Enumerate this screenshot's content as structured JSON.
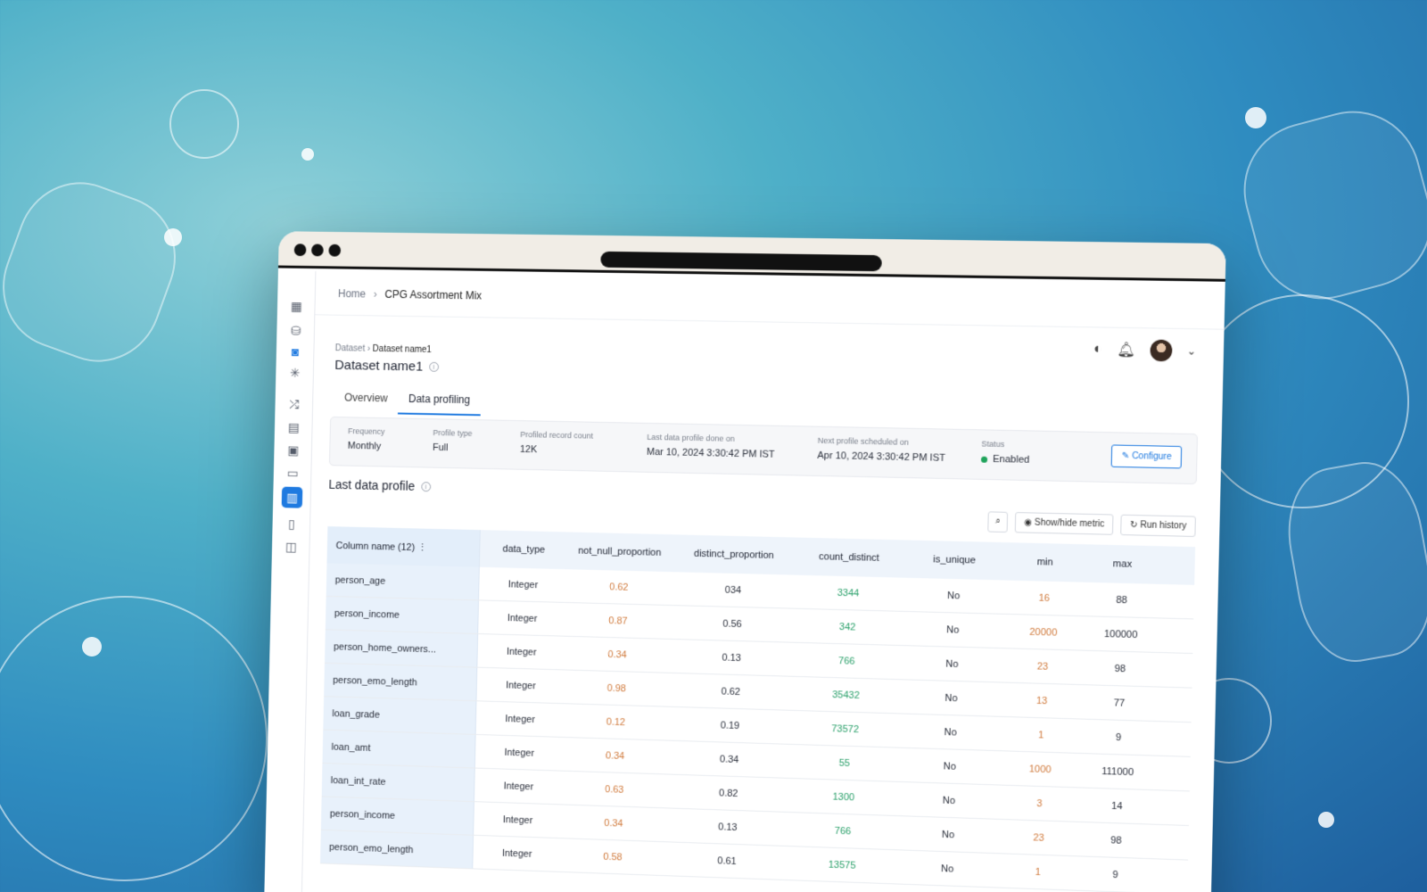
{
  "window": {
    "breadcrumb": {
      "home": "Home",
      "current": "CPG Assortment Mix"
    }
  },
  "header_icons": [
    "theme-toggle-icon",
    "bell-icon",
    "avatar",
    "chevron-down-icon"
  ],
  "dataset": {
    "crumb_parent": "Dataset",
    "crumb_current": "Dataset name1",
    "title": "Dataset name1"
  },
  "tabs": [
    {
      "label": "Overview",
      "active": false
    },
    {
      "label": "Data profiling",
      "active": true
    }
  ],
  "meta": {
    "frequency": {
      "label": "Frequency",
      "value": "Monthly"
    },
    "profile_type": {
      "label": "Profile type",
      "value": "Full"
    },
    "record_count": {
      "label": "Profiled record count",
      "value": "12K"
    },
    "last_profile": {
      "label": "Last data profile done on",
      "value": "Mar 10, 2024 3:30:42 PM IST"
    },
    "next_profile": {
      "label": "Next profile scheduled on",
      "value": "Apr 10, 2024 3:30:42 PM IST"
    },
    "status": {
      "label": "Status",
      "value": "Enabled",
      "color": "#1fa35b"
    },
    "configure_label": "Configure"
  },
  "profile": {
    "section_title": "Last data profile",
    "show_hide_label": "Show/hide metric",
    "run_history_label": "Run history",
    "columns": [
      "Column name (12) ⋮",
      "data_type",
      "not_null_proportion",
      "distinct_proportion",
      "count_distinct",
      "is_unique",
      "min",
      "max"
    ],
    "rows": [
      [
        "person_age",
        "Integer",
        "0.62",
        "034",
        "3344",
        "No",
        "16",
        "88"
      ],
      [
        "person_income",
        "Integer",
        "0.87",
        "0.56",
        "342",
        "No",
        "20000",
        "100000"
      ],
      [
        "person_home_owners...",
        "Integer",
        "0.34",
        "0.13",
        "766",
        "No",
        "23",
        "98"
      ],
      [
        "person_emo_length",
        "Integer",
        "0.98",
        "0.62",
        "35432",
        "No",
        "13",
        "77"
      ],
      [
        "loan_grade",
        "Integer",
        "0.12",
        "0.19",
        "73572",
        "No",
        "1",
        "9"
      ],
      [
        "loan_amt",
        "Integer",
        "0.34",
        "0.34",
        "55",
        "No",
        "1000",
        "111000"
      ],
      [
        "loan_int_rate",
        "Integer",
        "0.63",
        "0.82",
        "1300",
        "No",
        "3",
        "14"
      ],
      [
        "person_income",
        "Integer",
        "0.34",
        "0.13",
        "766",
        "No",
        "23",
        "98"
      ],
      [
        "person_emo_length",
        "Integer",
        "0.58",
        "0.61",
        "13575",
        "No",
        "1",
        "9"
      ]
    ]
  },
  "colors": {
    "accent": "#1f7ae0",
    "orange": "#d07a3c",
    "green": "#2aa06a"
  }
}
